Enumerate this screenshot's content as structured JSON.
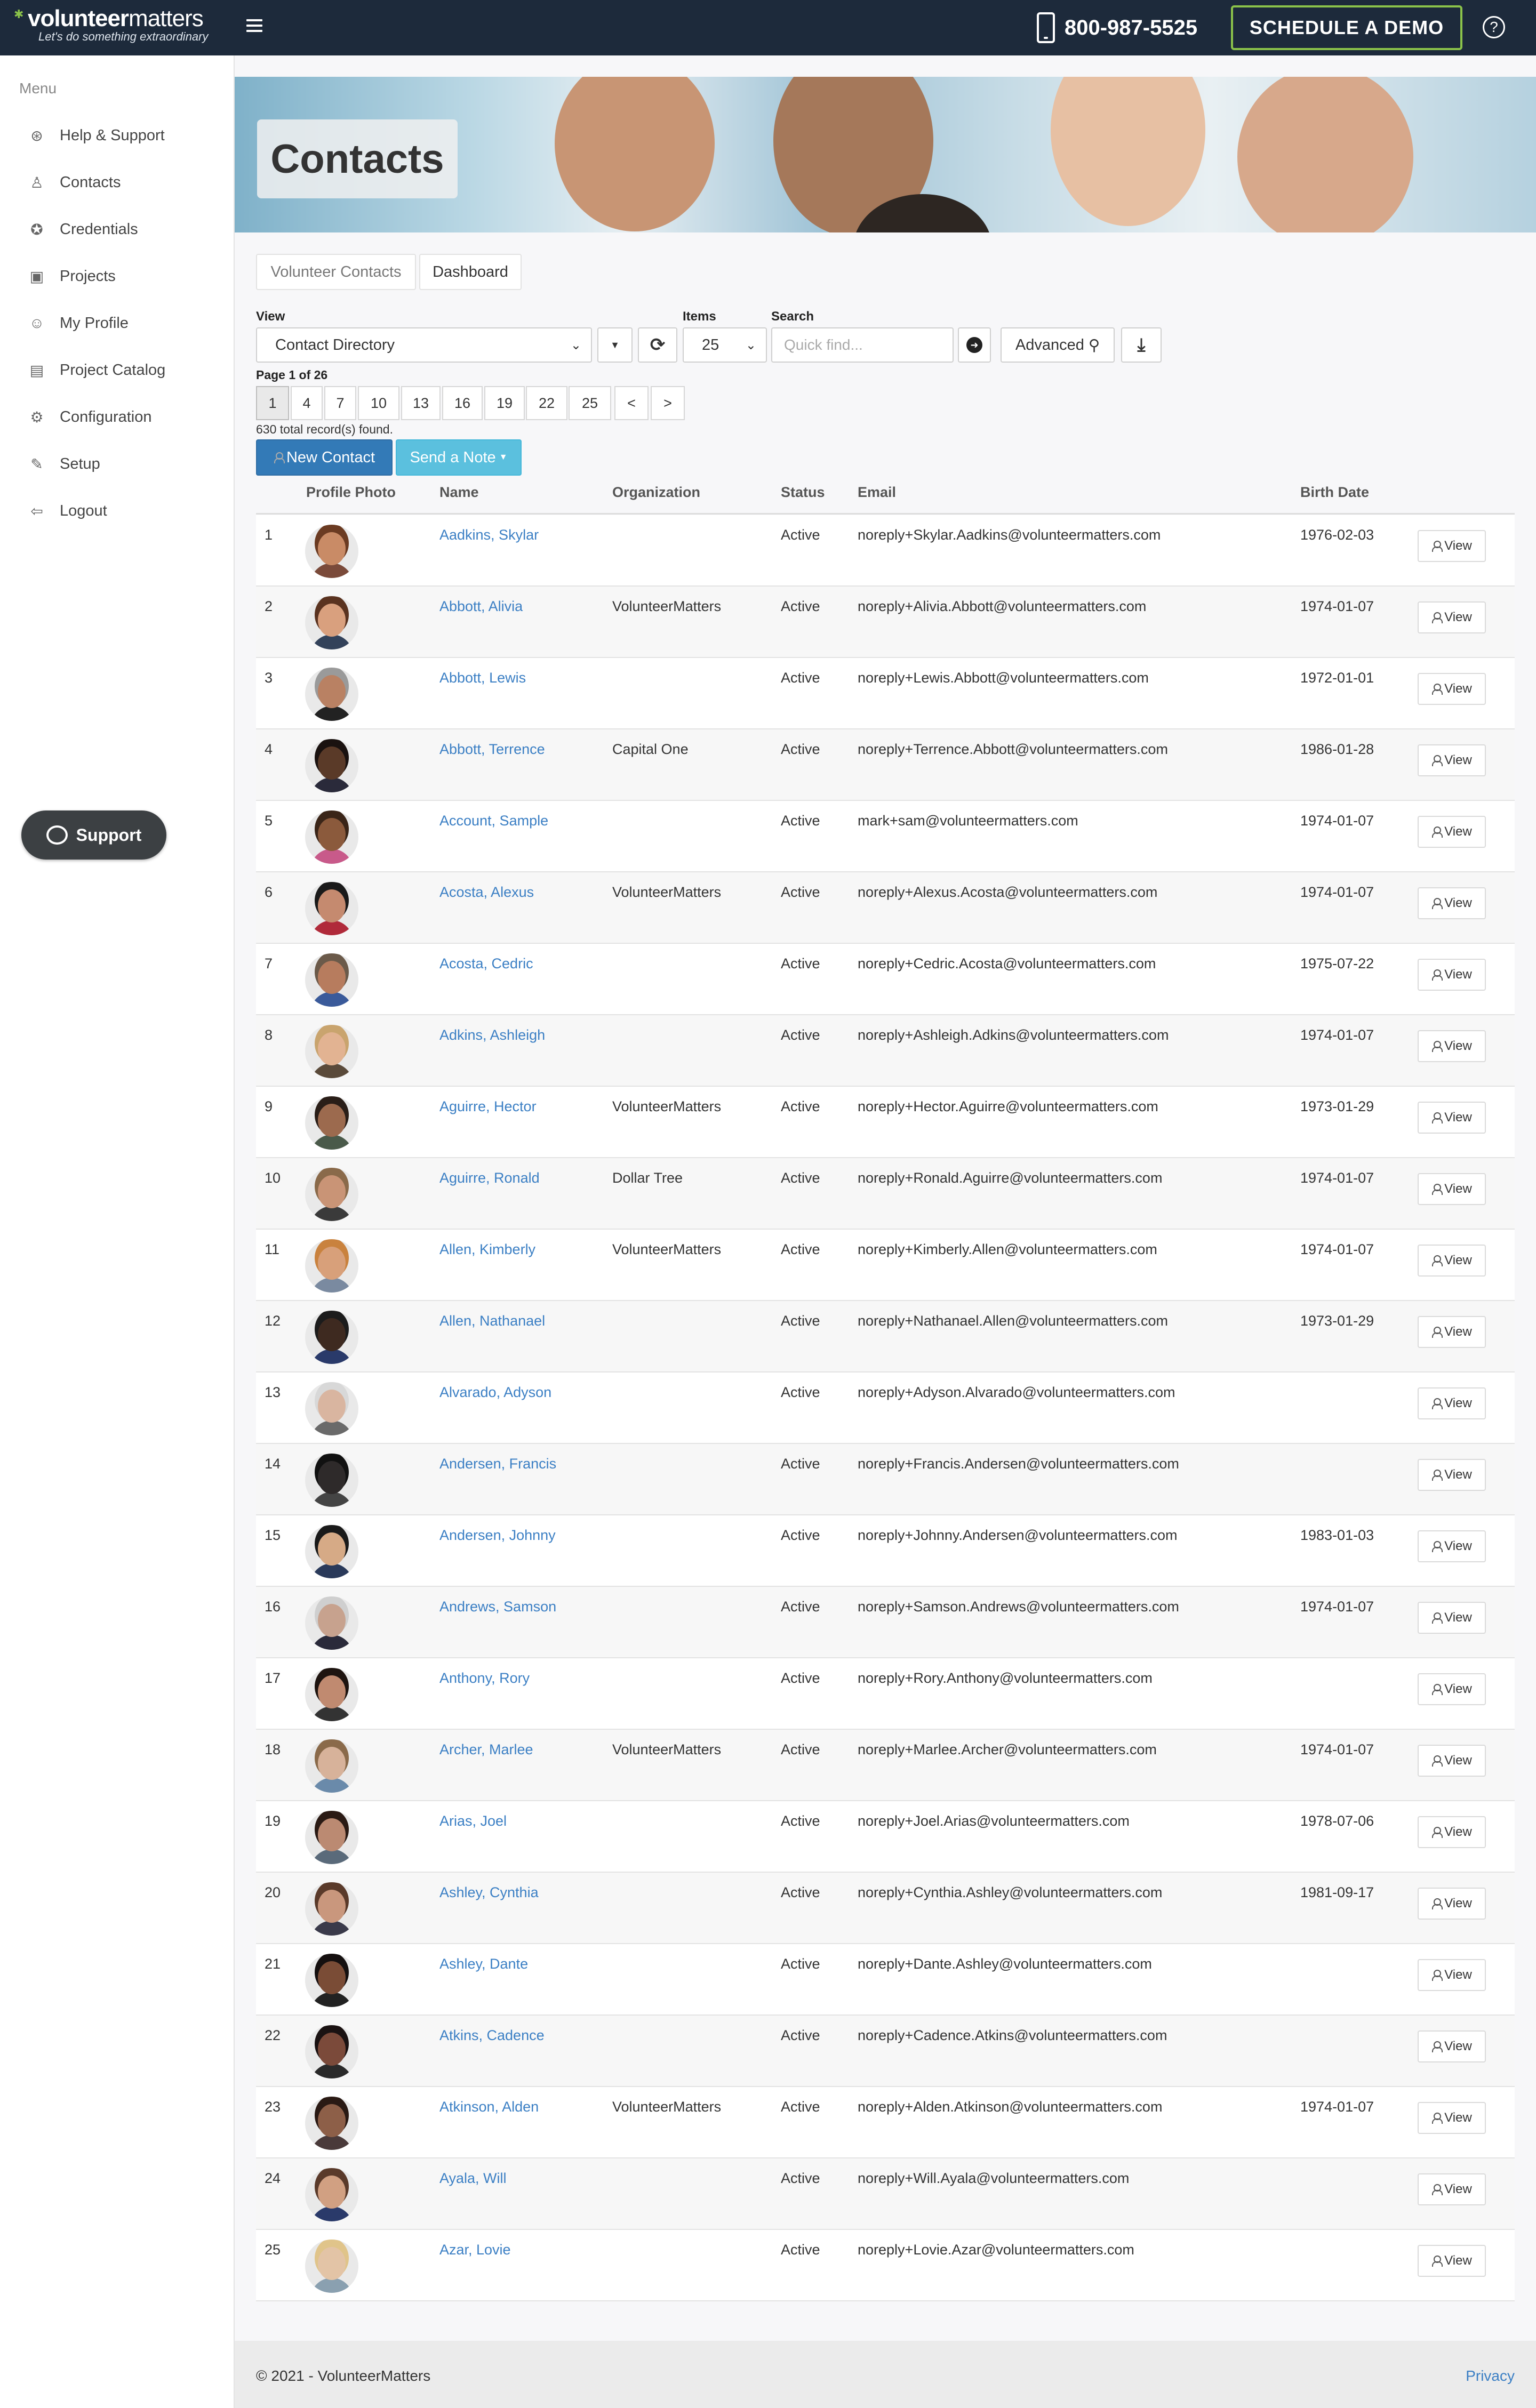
{
  "header": {
    "logo_bold": "volunteer",
    "logo_thin": "matters",
    "tagline": "Let's do something extraordinary",
    "phone": "800-987-5525",
    "demo_label": "SCHEDULE A DEMO",
    "help_glyph": "?"
  },
  "sidebar": {
    "menu_label": "Menu",
    "items": [
      {
        "label": "Help & Support",
        "icon": "life-ring-icon",
        "glyph": "⊛"
      },
      {
        "label": "Contacts",
        "icon": "user-icon",
        "glyph": "♙"
      },
      {
        "label": "Credentials",
        "icon": "award-icon",
        "glyph": "✪"
      },
      {
        "label": "Projects",
        "icon": "briefcase-icon",
        "glyph": "▣"
      },
      {
        "label": "My Profile",
        "icon": "smiley-icon",
        "glyph": "☺"
      },
      {
        "label": "Project Catalog",
        "icon": "book-icon",
        "glyph": "▤"
      },
      {
        "label": "Configuration",
        "icon": "gear-icon",
        "glyph": "⚙"
      },
      {
        "label": "Setup",
        "icon": "wrench-icon",
        "glyph": "✎"
      },
      {
        "label": "Logout",
        "icon": "logout-icon",
        "glyph": "⇦"
      }
    ],
    "support_label": "Support"
  },
  "page": {
    "title": "Contacts",
    "tabs": [
      "Volunteer Contacts",
      "Dashboard"
    ]
  },
  "controls": {
    "view_label": "View",
    "view_value": "Contact Directory",
    "items_label": "Items",
    "items_value": "25",
    "search_label": "Search",
    "search_placeholder": "Quick find...",
    "advanced_label": "Advanced",
    "page_info": "Page 1 of 26",
    "pages": [
      "1",
      "4",
      "7",
      "10",
      "13",
      "16",
      "19",
      "22",
      "25",
      "<",
      ">"
    ],
    "records_found": "630 total record(s) found.",
    "new_contact_label": "New Contact",
    "send_note_label": "Send a Note"
  },
  "table": {
    "headers": {
      "photo": "Profile Photo",
      "name": "Name",
      "org": "Organization",
      "status": "Status",
      "email": "Email",
      "birth": "Birth Date"
    },
    "view_label": "View",
    "rows": [
      {
        "n": "1",
        "name": "Aadkins, Skylar",
        "org": "",
        "status": "Active",
        "email": "noreply+Skylar.Aadkins@volunteermatters.com",
        "birth": "1976-02-03"
      },
      {
        "n": "2",
        "name": "Abbott, Alivia",
        "org": "VolunteerMatters",
        "status": "Active",
        "email": "noreply+Alivia.Abbott@volunteermatters.com",
        "birth": "1974-01-07"
      },
      {
        "n": "3",
        "name": "Abbott, Lewis",
        "org": "",
        "status": "Active",
        "email": "noreply+Lewis.Abbott@volunteermatters.com",
        "birth": "1972-01-01"
      },
      {
        "n": "4",
        "name": "Abbott, Terrence",
        "org": "Capital One",
        "status": "Active",
        "email": "noreply+Terrence.Abbott@volunteermatters.com",
        "birth": "1986-01-28"
      },
      {
        "n": "5",
        "name": "Account, Sample",
        "org": "",
        "status": "Active",
        "email": "mark+sam@volunteermatters.com",
        "birth": "1974-01-07"
      },
      {
        "n": "6",
        "name": "Acosta, Alexus",
        "org": "VolunteerMatters",
        "status": "Active",
        "email": "noreply+Alexus.Acosta@volunteermatters.com",
        "birth": "1974-01-07"
      },
      {
        "n": "7",
        "name": "Acosta, Cedric",
        "org": "",
        "status": "Active",
        "email": "noreply+Cedric.Acosta@volunteermatters.com",
        "birth": "1975-07-22"
      },
      {
        "n": "8",
        "name": "Adkins, Ashleigh",
        "org": "",
        "status": "Active",
        "email": "noreply+Ashleigh.Adkins@volunteermatters.com",
        "birth": "1974-01-07"
      },
      {
        "n": "9",
        "name": "Aguirre, Hector",
        "org": "VolunteerMatters",
        "status": "Active",
        "email": "noreply+Hector.Aguirre@volunteermatters.com",
        "birth": "1973-01-29"
      },
      {
        "n": "10",
        "name": "Aguirre, Ronald",
        "org": "Dollar Tree",
        "status": "Active",
        "email": "noreply+Ronald.Aguirre@volunteermatters.com",
        "birth": "1974-01-07"
      },
      {
        "n": "11",
        "name": "Allen, Kimberly",
        "org": "VolunteerMatters",
        "status": "Active",
        "email": "noreply+Kimberly.Allen@volunteermatters.com",
        "birth": "1974-01-07"
      },
      {
        "n": "12",
        "name": "Allen, Nathanael",
        "org": "",
        "status": "Active",
        "email": "noreply+Nathanael.Allen@volunteermatters.com",
        "birth": "1973-01-29"
      },
      {
        "n": "13",
        "name": "Alvarado, Adyson",
        "org": "",
        "status": "Active",
        "email": "noreply+Adyson.Alvarado@volunteermatters.com",
        "birth": ""
      },
      {
        "n": "14",
        "name": "Andersen, Francis",
        "org": "",
        "status": "Active",
        "email": "noreply+Francis.Andersen@volunteermatters.com",
        "birth": ""
      },
      {
        "n": "15",
        "name": "Andersen, Johnny",
        "org": "",
        "status": "Active",
        "email": "noreply+Johnny.Andersen@volunteermatters.com",
        "birth": "1983-01-03"
      },
      {
        "n": "16",
        "name": "Andrews, Samson",
        "org": "",
        "status": "Active",
        "email": "noreply+Samson.Andrews@volunteermatters.com",
        "birth": "1974-01-07"
      },
      {
        "n": "17",
        "name": "Anthony, Rory",
        "org": "",
        "status": "Active",
        "email": "noreply+Rory.Anthony@volunteermatters.com",
        "birth": ""
      },
      {
        "n": "18",
        "name": "Archer, Marlee",
        "org": "VolunteerMatters",
        "status": "Active",
        "email": "noreply+Marlee.Archer@volunteermatters.com",
        "birth": "1974-01-07"
      },
      {
        "n": "19",
        "name": "Arias, Joel",
        "org": "",
        "status": "Active",
        "email": "noreply+Joel.Arias@volunteermatters.com",
        "birth": "1978-07-06"
      },
      {
        "n": "20",
        "name": "Ashley, Cynthia",
        "org": "",
        "status": "Active",
        "email": "noreply+Cynthia.Ashley@volunteermatters.com",
        "birth": "1981-09-17"
      },
      {
        "n": "21",
        "name": "Ashley, Dante",
        "org": "",
        "status": "Active",
        "email": "noreply+Dante.Ashley@volunteermatters.com",
        "birth": ""
      },
      {
        "n": "22",
        "name": "Atkins, Cadence",
        "org": "",
        "status": "Active",
        "email": "noreply+Cadence.Atkins@volunteermatters.com",
        "birth": ""
      },
      {
        "n": "23",
        "name": "Atkinson, Alden",
        "org": "VolunteerMatters",
        "status": "Active",
        "email": "noreply+Alden.Atkinson@volunteermatters.com",
        "birth": "1974-01-07"
      },
      {
        "n": "24",
        "name": "Ayala, Will",
        "org": "",
        "status": "Active",
        "email": "noreply+Will.Ayala@volunteermatters.com",
        "birth": ""
      },
      {
        "n": "25",
        "name": "Azar, Lovie",
        "org": "",
        "status": "Active",
        "email": "noreply+Lovie.Azar@volunteermatters.com",
        "birth": ""
      }
    ]
  },
  "footer": {
    "copyright": "© 2021 - VolunteerMatters",
    "privacy": "Privacy"
  },
  "colors": {
    "topbar": "#1d2a3b",
    "accent_green": "#8bc34a",
    "link_blue": "#3b7fc4",
    "primary": "#337ab7",
    "info": "#5bc0de"
  }
}
